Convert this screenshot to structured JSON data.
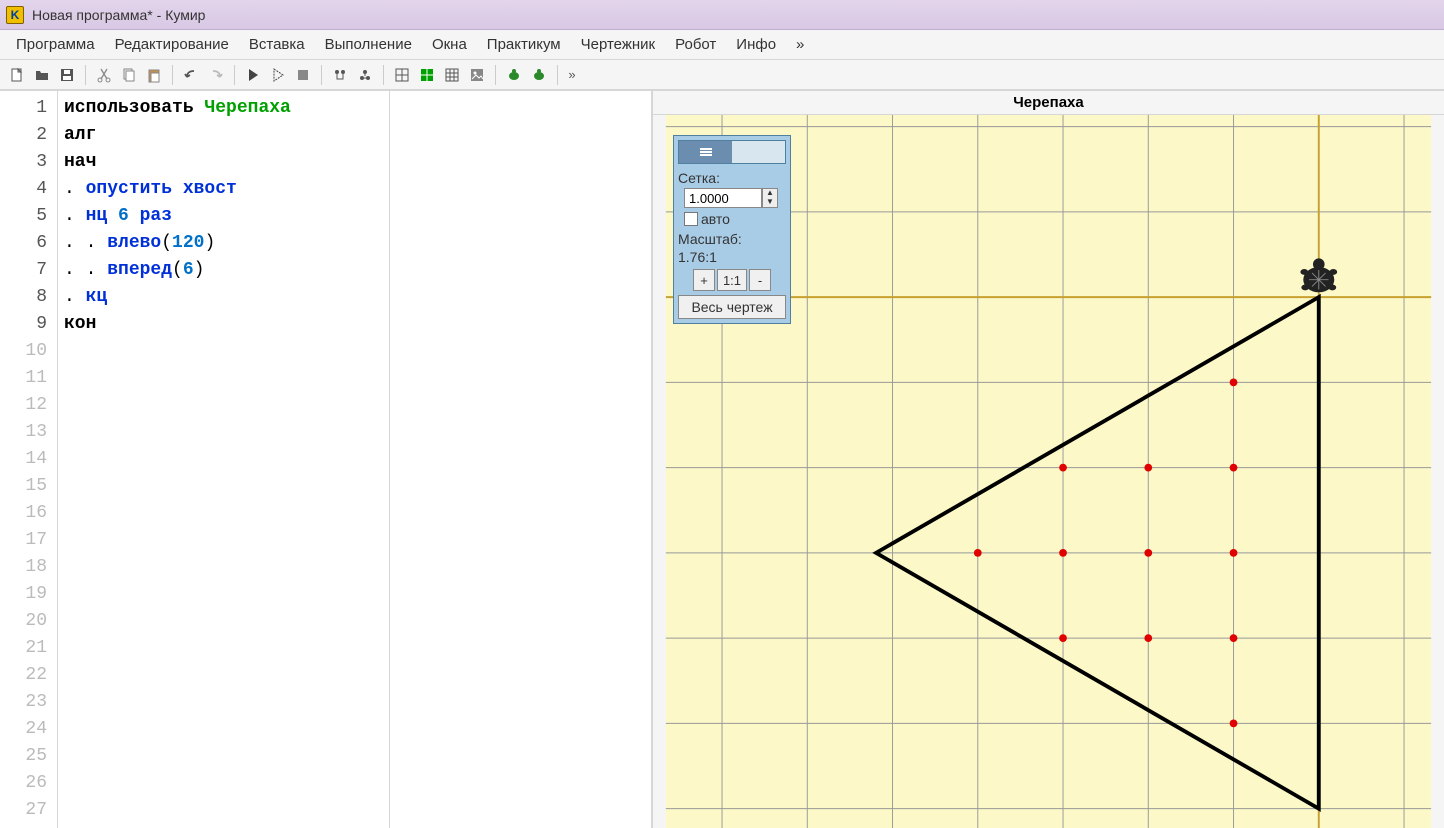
{
  "window": {
    "title": "Новая программа* - Кумир",
    "app_icon_letter": "K"
  },
  "menu": {
    "items": [
      "Программа",
      "Редактирование",
      "Вставка",
      "Выполнение",
      "Окна",
      "Практикум",
      "Чертежник",
      "Робот",
      "Инфо",
      "»"
    ]
  },
  "turtle": {
    "title": "Черепаха",
    "panel": {
      "grid_label": "Сетка:",
      "grid_value": "1.0000",
      "auto_label": "авто",
      "scale_label": "Масштаб:",
      "scale_value": "1.76:1",
      "zoom_in": "+",
      "zoom_reset": "1:1",
      "zoom_out": "-",
      "fit_label": "Весь чертеж"
    }
  },
  "code": {
    "lines": [
      {
        "n": 1,
        "segments": [
          {
            "t": "использовать ",
            "c": "kw"
          },
          {
            "t": "Черепаха",
            "c": "lib"
          }
        ]
      },
      {
        "n": 2,
        "segments": [
          {
            "t": "алг",
            "c": "kw"
          }
        ]
      },
      {
        "n": 3,
        "segments": [
          {
            "t": "нач",
            "c": "kw"
          }
        ]
      },
      {
        "n": 4,
        "segments": [
          {
            "t": ". ",
            "c": "punct"
          },
          {
            "t": "опустить хвост",
            "c": "kw-blue"
          }
        ]
      },
      {
        "n": 5,
        "segments": [
          {
            "t": ". ",
            "c": "punct"
          },
          {
            "t": "нц ",
            "c": "kw-blue"
          },
          {
            "t": "6",
            "c": "num"
          },
          {
            "t": " раз",
            "c": "kw-blue"
          }
        ]
      },
      {
        "n": 6,
        "segments": [
          {
            "t": ". . ",
            "c": "punct"
          },
          {
            "t": "влево",
            "c": "kw-blue"
          },
          {
            "t": "(",
            "c": "punct"
          },
          {
            "t": "120",
            "c": "num"
          },
          {
            "t": ")",
            "c": "punct"
          }
        ]
      },
      {
        "n": 7,
        "segments": [
          {
            "t": ". . ",
            "c": "punct"
          },
          {
            "t": "вперед",
            "c": "kw-blue"
          },
          {
            "t": "(",
            "c": "punct"
          },
          {
            "t": "6",
            "c": "num"
          },
          {
            "t": ")",
            "c": "punct"
          }
        ]
      },
      {
        "n": 8,
        "segments": [
          {
            "t": ". ",
            "c": "punct"
          },
          {
            "t": "кц",
            "c": "kw-blue"
          }
        ]
      },
      {
        "n": 9,
        "segments": [
          {
            "t": "кон",
            "c": "kw"
          }
        ]
      }
    ],
    "empty_lines": [
      10,
      11,
      12,
      13,
      14,
      15,
      16,
      17,
      18,
      19,
      20,
      21,
      22,
      23,
      24,
      25,
      26,
      27
    ]
  }
}
